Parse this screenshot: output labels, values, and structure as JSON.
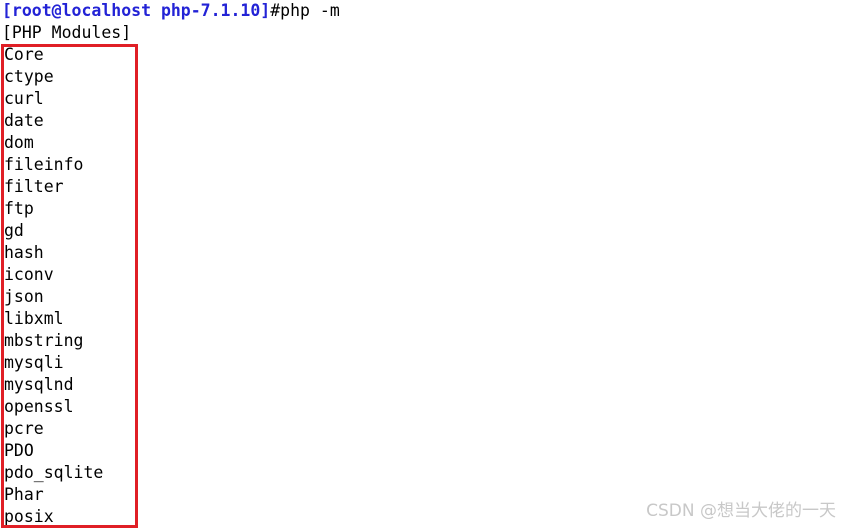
{
  "terminal": {
    "prompt_line": {
      "prompt": "[root@localhost php-7.1.10]",
      "command": "#php -m",
      "prompt_color": "#2323d6",
      "command_color": "#000000"
    },
    "header_line": "[PHP Modules]",
    "modules": [
      "Core",
      "ctype",
      "curl",
      "date",
      "dom",
      "fileinfo",
      "filter",
      "ftp",
      "gd",
      "hash",
      "iconv",
      "json",
      "libxml",
      "mbstring",
      "mysqli",
      "mysqlnd",
      "openssl",
      "pcre",
      "PDO",
      "pdo_sqlite",
      "Phar",
      "posix"
    ]
  },
  "annotation": {
    "highlight_box_color": "#e01f26",
    "highlight_box_label": "php-modules-highlight"
  },
  "watermark": {
    "text": "CSDN @想当大佬的一天",
    "color": "#c8c8c8"
  }
}
